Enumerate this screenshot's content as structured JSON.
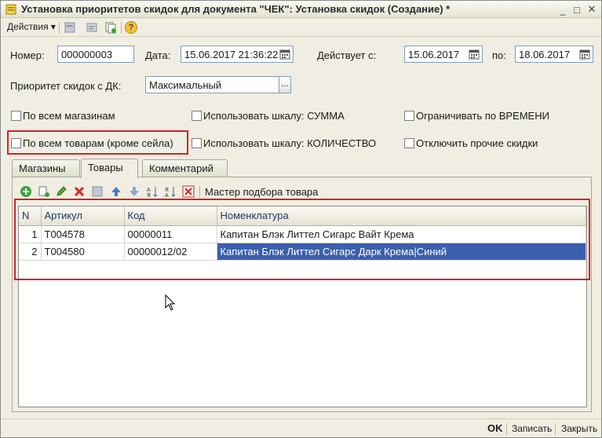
{
  "window": {
    "title": "Установка приоритетов скидок для документа \"ЧЕК\": Установка скидок (Создание) *",
    "minimize": "_",
    "maximize": "□",
    "close": "✕"
  },
  "toolbar": {
    "actions_label": "Действия ▾",
    "help": "?"
  },
  "form": {
    "number_label": "Номер:",
    "number_value": "000000003",
    "date_label": "Дата:",
    "date_value": "15.06.2017 21:36:22",
    "valid_from_label": "Действует с:",
    "valid_from_value": "15.06.2017",
    "to_label": "по:",
    "to_value": "18.06.2017",
    "priority_label": "Приоритет скидок с ДК:",
    "priority_value": "Максимальный",
    "ellipsis": "..."
  },
  "checkboxes": {
    "all_stores": "По всем магазинам",
    "all_goods": "По всем товарам (кроме сейла)",
    "scale_sum": "Использовать шкалу: СУММА",
    "scale_qty": "Использовать шкалу: КОЛИЧЕСТВО",
    "limit_time": "Ограничивать по ВРЕМЕНИ",
    "disable_other": "Отключить прочие скидки"
  },
  "tabs": [
    "Магазины",
    "Товары",
    "Комментарий"
  ],
  "grid_toolbar": {
    "wizard_label": "Мастер подбора товара"
  },
  "table": {
    "columns": [
      "N",
      "Артикул",
      "Код",
      "Номенклатура"
    ],
    "rows": [
      {
        "n": "1",
        "article": "T004578",
        "code": "00000011",
        "name": "Капитан Блэк Литтел Сигарс Вайт Крема"
      },
      {
        "n": "2",
        "article": "T004580",
        "code": "00000012/02",
        "name": "Капитан Блэк Литтел Сигарс Дарк Крема|Синий"
      }
    ]
  },
  "footer": {
    "ok": "OK",
    "save": "Записать",
    "close": "Закрыть"
  },
  "colors": {
    "highlight_red": "#d6202a",
    "selection_blue": "#3b5fae"
  }
}
